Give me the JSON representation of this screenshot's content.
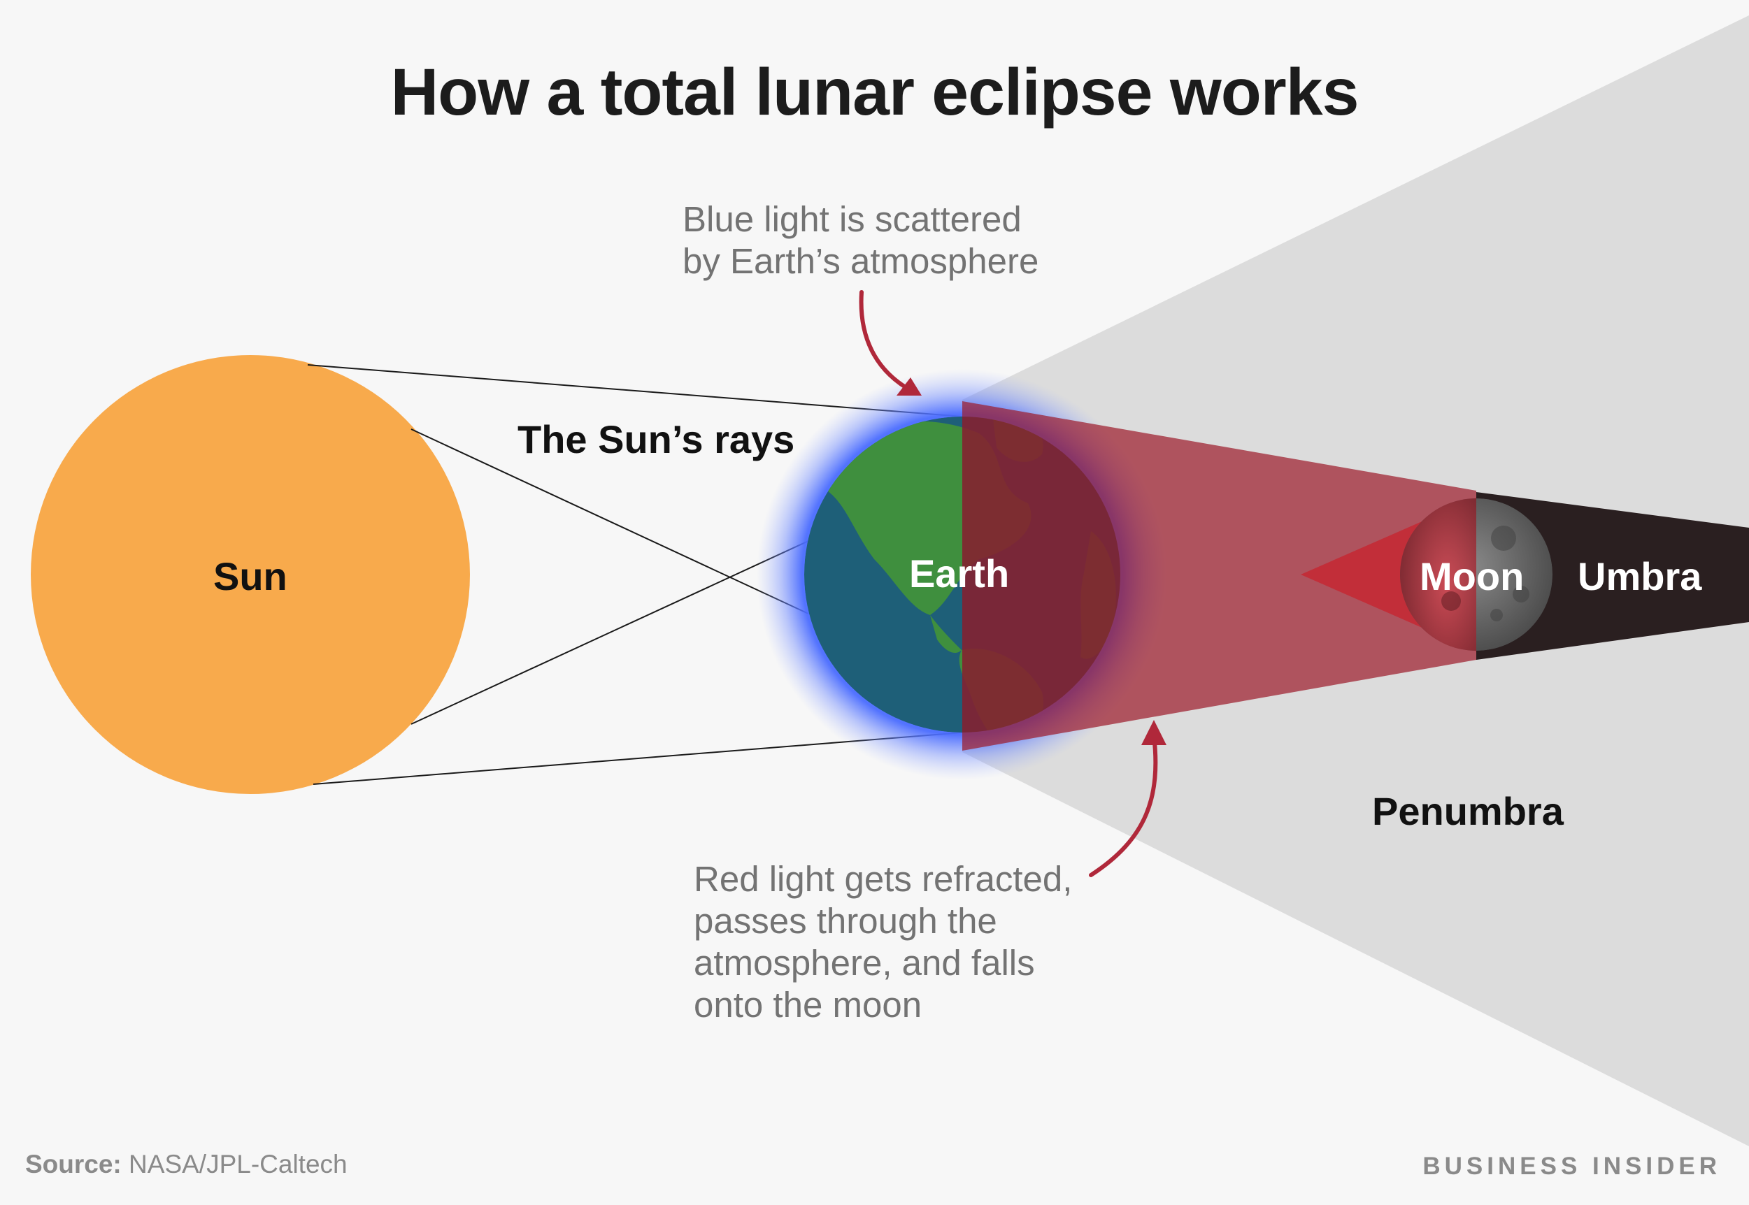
{
  "title": "How a total lunar eclipse works",
  "labels": {
    "sun": "Sun",
    "earth": "Earth",
    "moon": "Moon",
    "umbra": "Umbra",
    "penumbra": "Penumbra",
    "rays": "The Sun’s rays"
  },
  "annotations": {
    "blue_light": "Blue light is scattered\nby Earth’s atmosphere",
    "red_light": "Red light gets refracted,\npasses through the\natmosphere, and falls\nonto the moon"
  },
  "footer": {
    "source_label": "Source:",
    "source_text": "NASA/JPL-Caltech",
    "brand": "BUSINESS INSIDER"
  },
  "colors": {
    "background": "#f7f7f7",
    "sun": "#f8aa4c",
    "earth_ocean": "#1e5f78",
    "earth_land": "#3f8f3e",
    "atmosphere_glow": "#4a6cff",
    "red_light": "#9e1f2e",
    "umbra": "#2a1f20",
    "penumbra": "#dcdcdc",
    "arrow": "#b0283a"
  }
}
